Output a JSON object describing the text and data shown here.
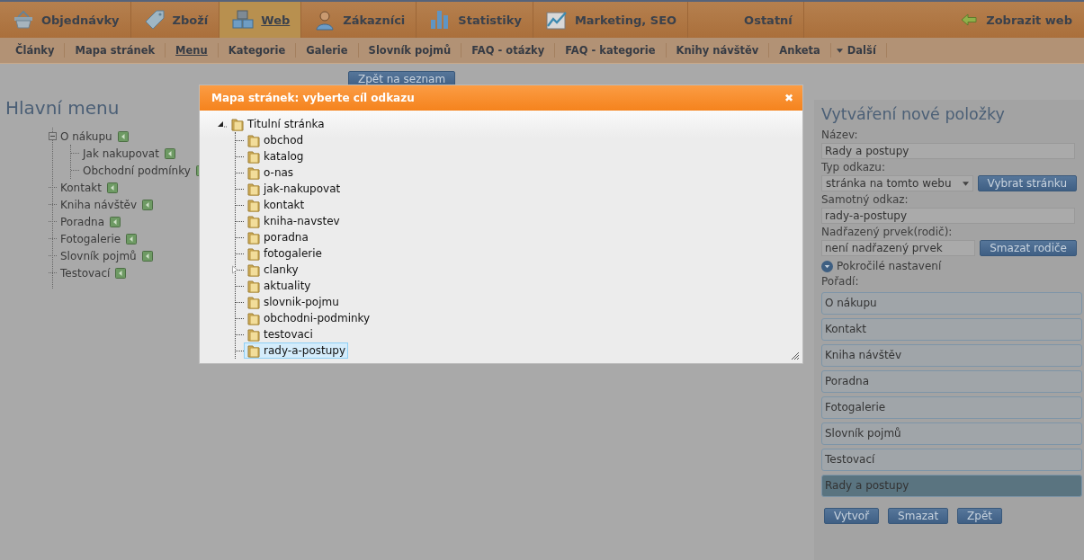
{
  "main_nav": {
    "items": [
      {
        "label": "Objednávky",
        "selected": false
      },
      {
        "label": "Zboží",
        "selected": false
      },
      {
        "label": "Web",
        "selected": true
      },
      {
        "label": "Zákazníci",
        "selected": false
      },
      {
        "label": "Statistiky",
        "selected": false
      },
      {
        "label": "Marketing, SEO",
        "selected": false
      },
      {
        "label": "Ostatní",
        "selected": false
      }
    ],
    "view_site": "Zobrazit web"
  },
  "sub_nav": {
    "items": [
      {
        "label": "Články",
        "selected": false
      },
      {
        "label": "Mapa stránek",
        "selected": false
      },
      {
        "label": "Menu",
        "selected": true
      },
      {
        "label": "Kategorie",
        "selected": false
      },
      {
        "label": "Galerie",
        "selected": false
      },
      {
        "label": "Slovník pojmů",
        "selected": false
      },
      {
        "label": "FAQ - otázky",
        "selected": false
      },
      {
        "label": "FAQ - kategorie",
        "selected": false
      },
      {
        "label": "Knihy návštěv",
        "selected": false
      },
      {
        "label": "Anketa",
        "selected": false
      }
    ],
    "more": "Další"
  },
  "back_button": "Zpět na seznam",
  "main_menu": {
    "title": "Hlavní menu",
    "items": [
      {
        "label": "O nákupu",
        "expanded": true,
        "children": [
          {
            "label": "Jak nakupovat"
          },
          {
            "label": "Obchodní podmínky"
          }
        ]
      },
      {
        "label": "Kontakt"
      },
      {
        "label": "Kniha návštěv"
      },
      {
        "label": "Poradna"
      },
      {
        "label": "Fotogalerie"
      },
      {
        "label": "Slovník pojmů"
      },
      {
        "label": "Testovací"
      }
    ]
  },
  "form": {
    "title": "Vytváření nové položky",
    "name_label": "Název:",
    "name_value": "Rady a postupy",
    "type_label": "Typ odkazu:",
    "type_value": "stránka na tomto webu",
    "pick_button": "Vybrat stránku",
    "link_label": "Samotný odkaz:",
    "link_value": "rady-a-postupy",
    "parent_label": "Nadřazený prvek(rodič):",
    "parent_value": "není nadřazený prvek",
    "clear_parent_button": "Smazat rodiče",
    "advanced": "Pokročilé nastavení",
    "order_label": "Pořadí:",
    "order_items": [
      {
        "label": "O nákupu",
        "selected": false
      },
      {
        "label": "Kontakt",
        "selected": false
      },
      {
        "label": "Kniha návštěv",
        "selected": false
      },
      {
        "label": "Poradna",
        "selected": false
      },
      {
        "label": "Fotogalerie",
        "selected": false
      },
      {
        "label": "Slovník pojmů",
        "selected": false
      },
      {
        "label": "Testovací",
        "selected": false
      },
      {
        "label": "Rady a postupy",
        "selected": true
      }
    ],
    "buttons": [
      "Vytvoř",
      "Smazat",
      "Zpět"
    ]
  },
  "dialog": {
    "title": "Mapa stránek: vyberte cíl odkazu",
    "close": "✖",
    "tree": {
      "label": "Titulní stránka",
      "expanded": true,
      "children": [
        {
          "label": "obchod",
          "selected": false,
          "has_children": false
        },
        {
          "label": "katalog",
          "selected": false,
          "has_children": false
        },
        {
          "label": "o-nas",
          "selected": false,
          "has_children": false
        },
        {
          "label": "jak-nakupovat",
          "selected": false,
          "has_children": false
        },
        {
          "label": "kontakt",
          "selected": false,
          "has_children": false
        },
        {
          "label": "kniha-navstev",
          "selected": false,
          "has_children": false
        },
        {
          "label": "poradna",
          "selected": false,
          "has_children": false
        },
        {
          "label": "fotogalerie",
          "selected": false,
          "has_children": false
        },
        {
          "label": "clanky",
          "selected": false,
          "has_children": true
        },
        {
          "label": "aktuality",
          "selected": false,
          "has_children": false
        },
        {
          "label": "slovnik-pojmu",
          "selected": false,
          "has_children": false
        },
        {
          "label": "obchodni-podminky",
          "selected": false,
          "has_children": false
        },
        {
          "label": "testovaci",
          "selected": false,
          "has_children": false
        },
        {
          "label": "rady-a-postupy",
          "selected": true,
          "has_children": false
        }
      ]
    }
  }
}
